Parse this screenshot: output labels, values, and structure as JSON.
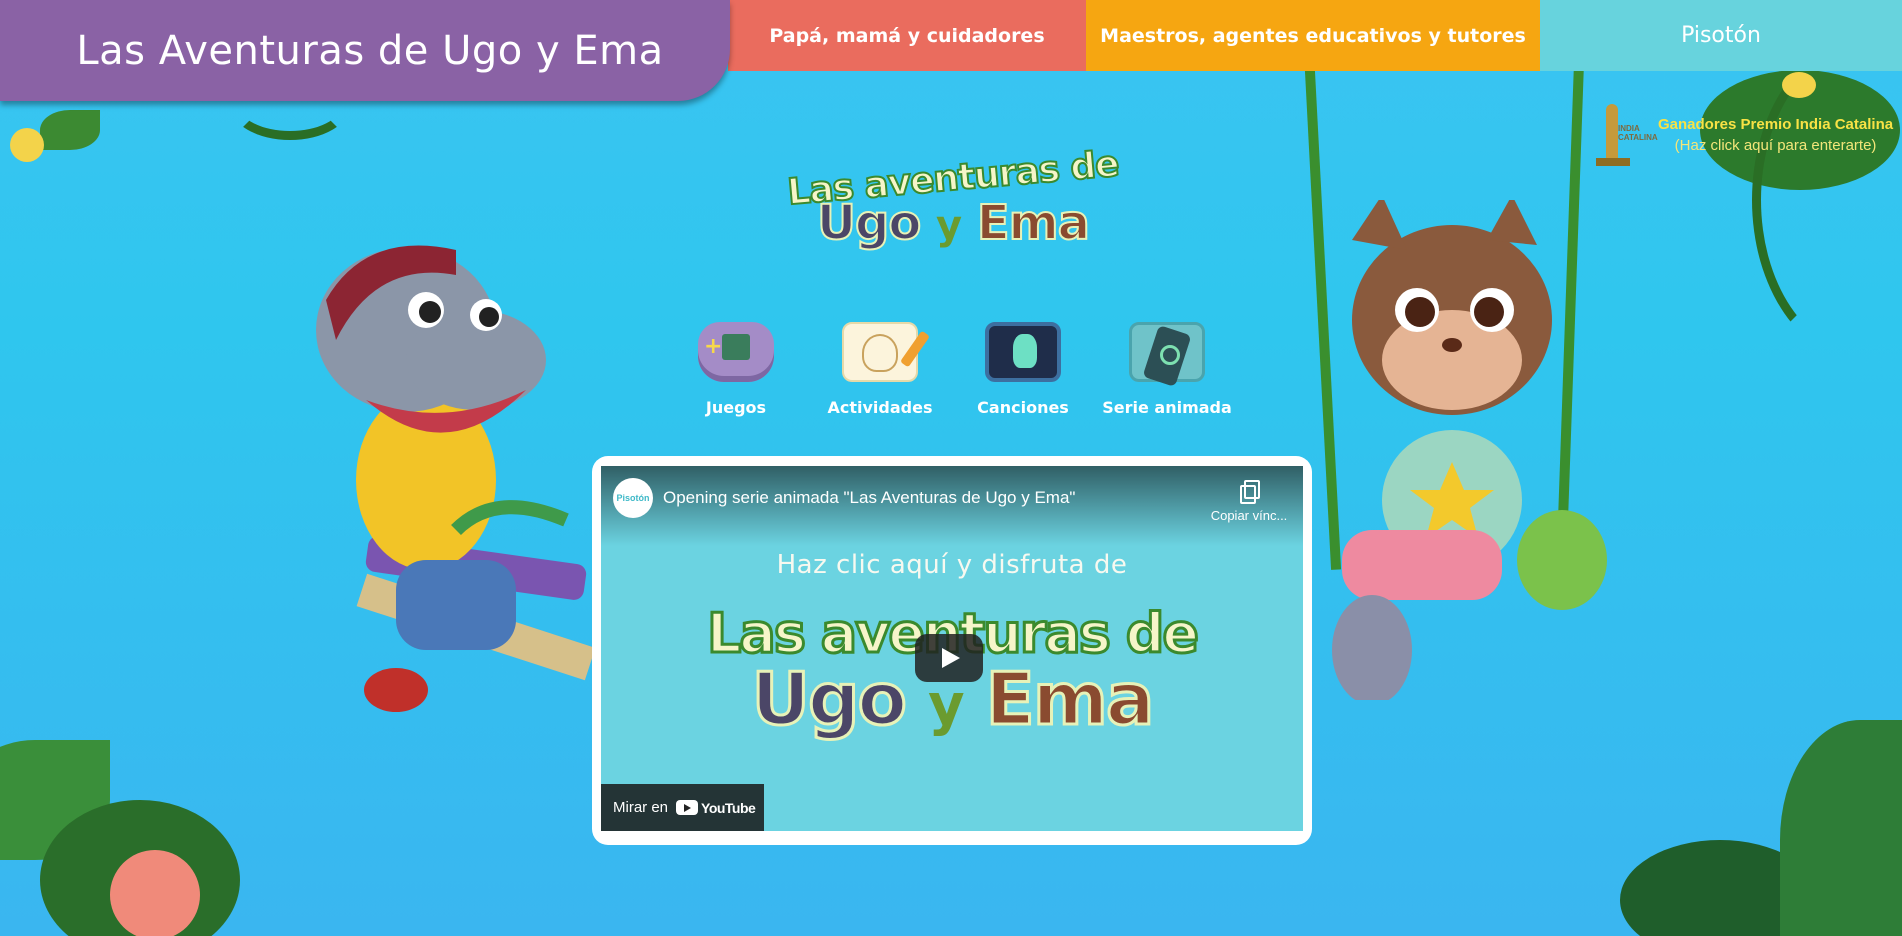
{
  "header": {
    "site_title": "Las Aventuras de Ugo y Ema",
    "nav": [
      {
        "label": "Papá, mamá y cuidadores",
        "color": "#ea6c5e"
      },
      {
        "label": "Maestros, agentes educativos y tutores",
        "color": "#f6a611"
      },
      {
        "label": "Pisotón",
        "color": "#67d3dd"
      }
    ]
  },
  "award": {
    "badge_text": "INDIA CATALINA",
    "line1": "Ganadores Premio India Catalina",
    "line2": "(Haz click aquí para enterarte)"
  },
  "logo": {
    "line1": "Las aventuras de",
    "ugo": "Ugo",
    "y": "y",
    "ema": "Ema"
  },
  "categories": [
    {
      "label": "Juegos",
      "icon": "game-console-icon"
    },
    {
      "label": "Actividades",
      "icon": "coloring-activity-icon"
    },
    {
      "label": "Canciones",
      "icon": "dancing-music-icon"
    },
    {
      "label": "Serie animada",
      "icon": "remote-control-icon"
    }
  ],
  "video": {
    "channel_avatar": "Pisotón",
    "title": "Opening serie animada \"Las Aventuras de Ugo y Ema\"",
    "copy_link": "Copiar vínc...",
    "tagline": "Haz clic aquí y disfruta de",
    "logo_line1": "Las aventuras de",
    "logo_ugo": "Ugo",
    "logo_y": "y",
    "logo_ema": "Ema",
    "watch_on": "Mirar en",
    "youtube": "YouTube"
  },
  "colors": {
    "background": "#33c5f0",
    "brand_purple": "#8a62a5"
  }
}
